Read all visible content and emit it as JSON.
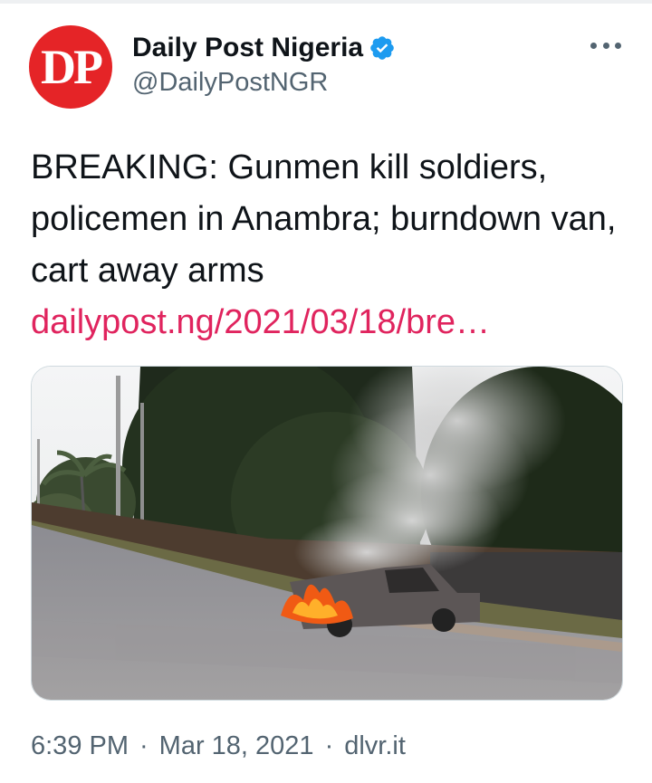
{
  "account": {
    "avatar_text": "DP",
    "display_name": "Daily Post Nigeria",
    "handle": "@DailyPostNGR",
    "verified_icon": "verified-badge-icon",
    "more_icon": "more-horizontal-icon"
  },
  "tweet": {
    "text": "BREAKING: Gunmen kill soldiers, policemen in Anambra; burndown van, cart away arms",
    "link": "dailypost.ng/2021/03/18/bre…",
    "media_icon": "photo-burning-van-icon"
  },
  "meta": {
    "time": "6:39 PM",
    "separator": "·",
    "date": "Mar 18, 2021",
    "source": "dlvr.it"
  },
  "colors": {
    "link": "#e0245e",
    "secondary_text": "#536471",
    "avatar_bg": "#e52427",
    "verified": "#1d9bf0"
  }
}
